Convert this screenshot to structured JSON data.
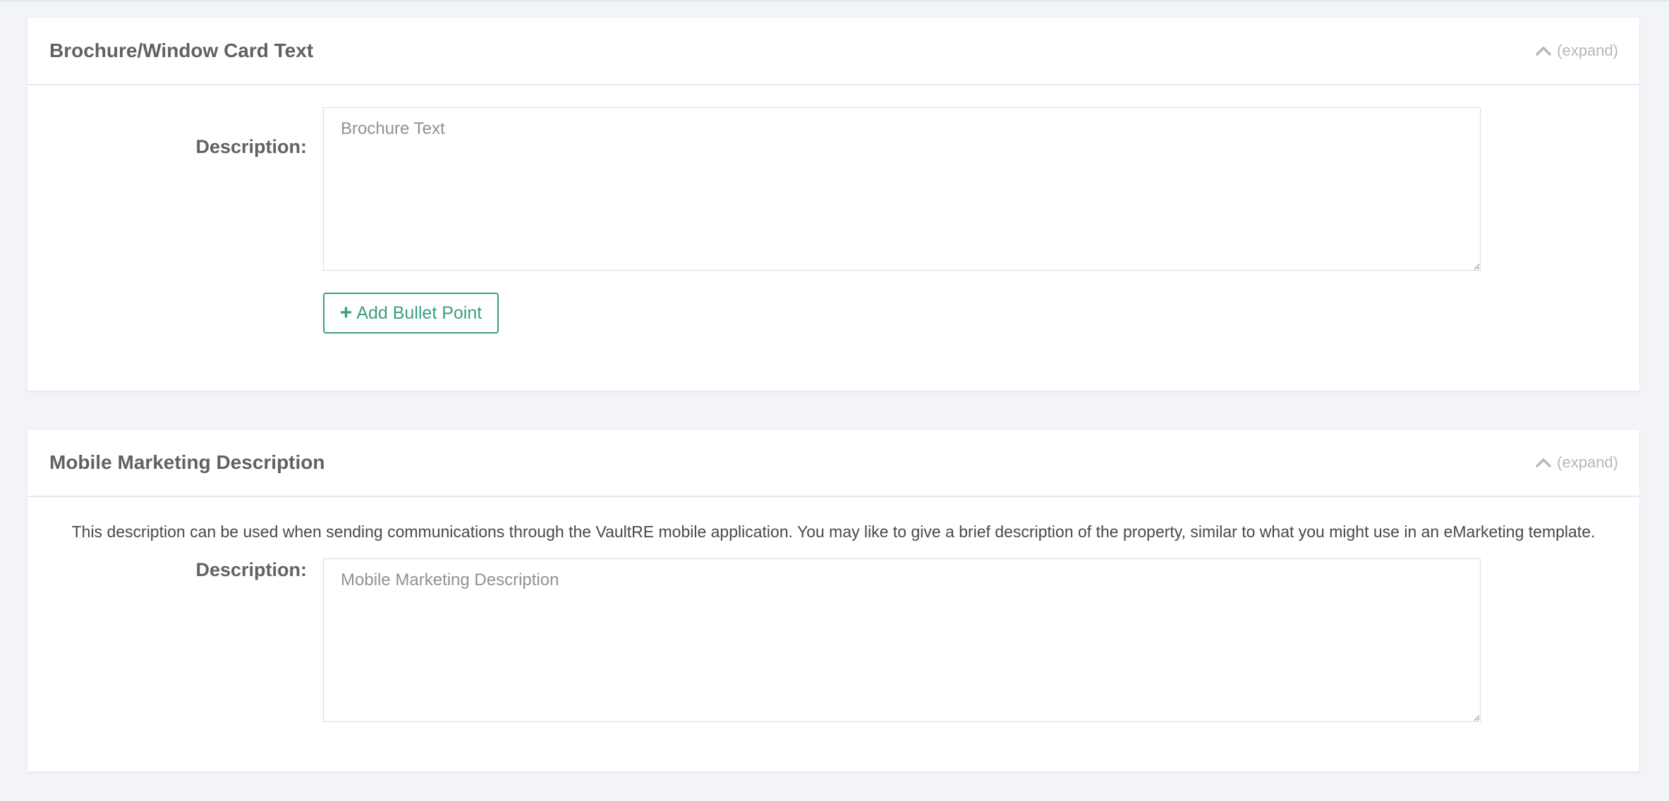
{
  "brochure_section": {
    "title": "Brochure/Window Card Text",
    "expand_label": "(expand)",
    "description_label": "Description:",
    "description_placeholder": "Brochure Text",
    "description_value": "",
    "add_bullet_label": "Add Bullet Point"
  },
  "mobile_section": {
    "title": "Mobile Marketing Description",
    "expand_label": "(expand)",
    "help_text": "This description can be used when sending communications through the VaultRE mobile application. You may like to give a brief description of the property, similar to what you might use in an eMarketing template.",
    "description_label": "Description:",
    "description_placeholder": "Mobile Marketing Description",
    "description_value": ""
  },
  "icons": {
    "expand": "chevron-up-icon",
    "add": "plus-icon"
  },
  "colors": {
    "accent": "#3a9e83",
    "background": "#f3f4f8",
    "panel": "#ffffff"
  }
}
